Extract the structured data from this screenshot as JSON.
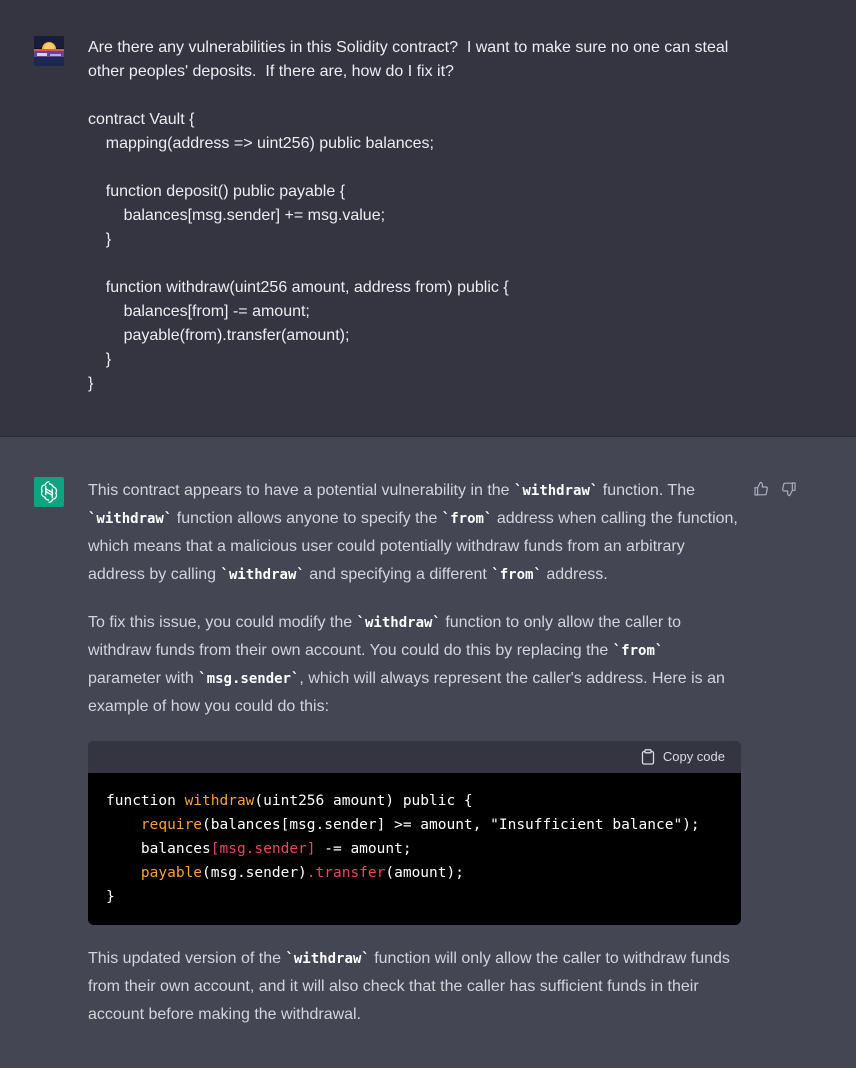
{
  "user": {
    "avatar": "user-avatar-sunset",
    "lines": [
      "Are there any vulnerabilities in this Solidity contract?  I want to make sure no one can steal",
      "other peoples' deposits.  If there are, how do I fix it?",
      "",
      "contract Vault {",
      "    mapping(address => uint256) public balances;",
      "",
      "    function deposit() public payable {",
      "        balances[msg.sender] += msg.value;",
      "    }",
      "",
      "    function withdraw(uint256 amount, address from) public {",
      "        balances[from] -= amount;",
      "        payable(from).transfer(amount);",
      "    }",
      "}"
    ]
  },
  "assistant": {
    "avatar": "openai-logo-icon",
    "feedback": {
      "up_icon": "thumbs-up-icon",
      "down_icon": "thumbs-down-icon"
    },
    "p1": [
      {
        "t": "text",
        "v": "This contract appears to have a potential vulnerability in the "
      },
      {
        "t": "code",
        "v": "`withdraw`"
      },
      {
        "t": "text",
        "v": " function. The "
      },
      {
        "t": "code",
        "v": "`withdraw`"
      },
      {
        "t": "text",
        "v": " function allows anyone to specify the "
      },
      {
        "t": "code",
        "v": "`from`"
      },
      {
        "t": "text",
        "v": " address when calling the function, which means that a malicious user could potentially withdraw funds from an arbitrary address by calling "
      },
      {
        "t": "code",
        "v": "`withdraw`"
      },
      {
        "t": "text",
        "v": " and specifying a different "
      },
      {
        "t": "code",
        "v": "`from`"
      },
      {
        "t": "text",
        "v": " address."
      }
    ],
    "p2": [
      {
        "t": "text",
        "v": "To fix this issue, you could modify the "
      },
      {
        "t": "code",
        "v": "`withdraw`"
      },
      {
        "t": "text",
        "v": " function to only allow the caller to withdraw funds from their own account. You could do this by replacing the "
      },
      {
        "t": "code",
        "v": "`from`"
      },
      {
        "t": "text",
        "v": " parameter with "
      },
      {
        "t": "code",
        "v": "`msg.sender`"
      },
      {
        "t": "text",
        "v": ", which will always represent the caller's address. Here is an example of how you could do this:"
      }
    ],
    "code_block": {
      "copy_label": "Copy code",
      "copy_icon": "clipboard-icon",
      "lines": [
        [
          {
            "c": "plain",
            "v": "function "
          },
          {
            "c": "fn",
            "v": "withdraw"
          },
          {
            "c": "plain",
            "v": "(uint256 amount) public {"
          }
        ],
        [
          {
            "c": "plain",
            "v": "    "
          },
          {
            "c": "kw",
            "v": "require"
          },
          {
            "c": "plain",
            "v": "(balances[msg.sender] >= amount, "
          },
          {
            "c": "str",
            "v": "\"Insufficient balance\""
          },
          {
            "c": "plain",
            "v": ");"
          }
        ],
        [
          {
            "c": "plain",
            "v": "    balances"
          },
          {
            "c": "var",
            "v": "[msg.sender]"
          },
          {
            "c": "plain",
            "v": " -= amount;"
          }
        ],
        [
          {
            "c": "plain",
            "v": "    "
          },
          {
            "c": "kw",
            "v": "payable"
          },
          {
            "c": "plain",
            "v": "(msg.sender)"
          },
          {
            "c": "var",
            "v": ".transfer"
          },
          {
            "c": "plain",
            "v": "(amount);"
          }
        ],
        [
          {
            "c": "plain",
            "v": "}"
          }
        ]
      ]
    },
    "p3": [
      {
        "t": "text",
        "v": "This updated version of the "
      },
      {
        "t": "code",
        "v": "`withdraw`"
      },
      {
        "t": "text",
        "v": " function will only allow the caller to withdraw funds from their own account, and it will also check that the caller has sufficient funds in their account before making the withdrawal."
      }
    ]
  },
  "colors": {
    "user_bg": "#343541",
    "assistant_bg": "#444654",
    "bot_avatar": "#10a37f"
  }
}
